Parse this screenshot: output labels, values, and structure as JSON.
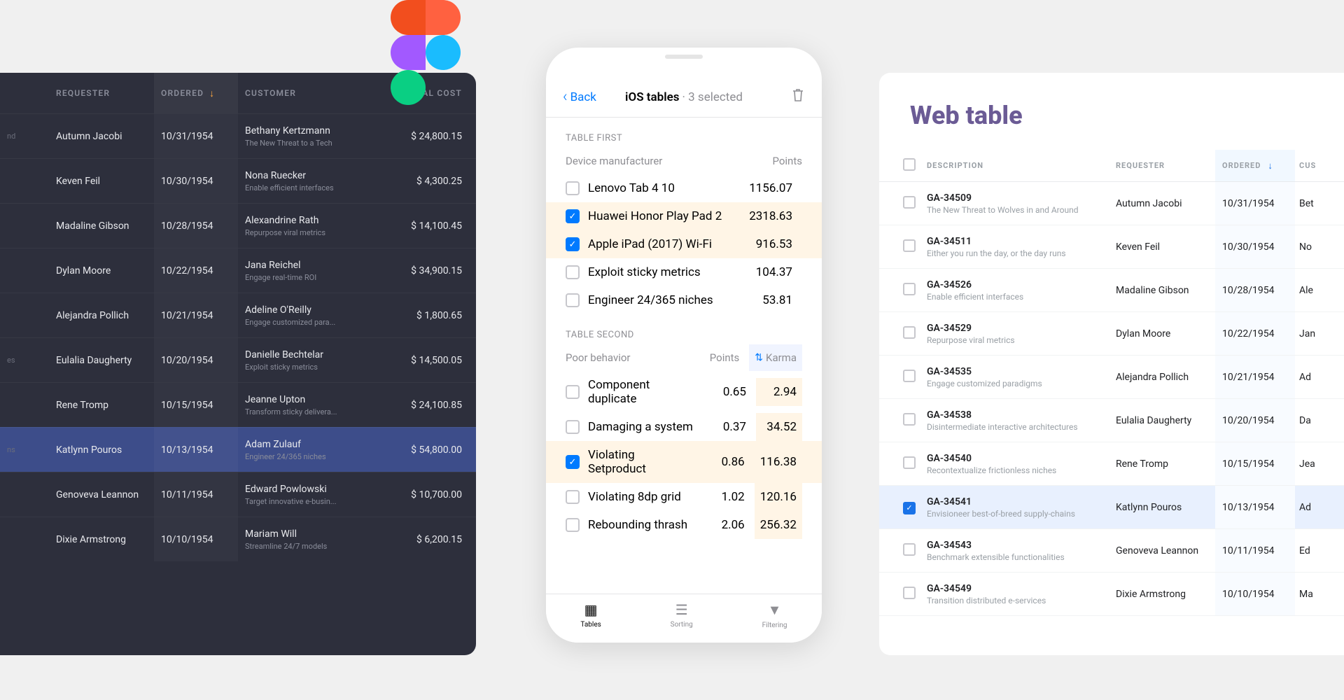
{
  "dark_table": {
    "headers": {
      "requester": "Requester",
      "ordered": "Ordered",
      "customer": "Customer",
      "total_cost": "Total Cost"
    },
    "rows": [
      {
        "stub": "nd",
        "requester": "Autumn Jacobi",
        "ordered": "10/31/1954",
        "cust_name": "Bethany Kertzmann",
        "cust_sub": "The New Threat to a Tech",
        "total": "$ 24,800.15",
        "selected": false
      },
      {
        "stub": "",
        "requester": "Keven Feil",
        "ordered": "10/30/1954",
        "cust_name": "Nona Ruecker",
        "cust_sub": "Enable efficient interfaces",
        "total": "$ 4,300.25",
        "selected": false
      },
      {
        "stub": "",
        "requester": "Madaline Gibson",
        "ordered": "10/28/1954",
        "cust_name": "Alexandrine Rath",
        "cust_sub": "Repurpose viral metrics",
        "total": "$ 14,100.45",
        "selected": false
      },
      {
        "stub": "",
        "requester": "Dylan Moore",
        "ordered": "10/22/1954",
        "cust_name": "Jana Reichel",
        "cust_sub": "Engage real-time ROI",
        "total": "$ 34,900.15",
        "selected": false
      },
      {
        "stub": "",
        "requester": "Alejandra Pollich",
        "ordered": "10/21/1954",
        "cust_name": "Adeline O'Reilly",
        "cust_sub": "Engage customized para...",
        "total": "$ 1,800.65",
        "selected": false
      },
      {
        "stub": "es",
        "requester": "Eulalia Daugherty",
        "ordered": "10/20/1954",
        "cust_name": "Danielle Bechtelar",
        "cust_sub": "Exploit sticky metrics",
        "total": "$ 14,500.05",
        "selected": false
      },
      {
        "stub": "",
        "requester": "Rene Tromp",
        "ordered": "10/15/1954",
        "cust_name": "Jeanne Upton",
        "cust_sub": "Transform sticky delivera...",
        "total": "$ 24,100.85",
        "selected": false
      },
      {
        "stub": "ns",
        "requester": "Katlynn Pouros",
        "ordered": "10/13/1954",
        "cust_name": "Adam Zulauf",
        "cust_sub": "Engineer 24/365 niches",
        "total": "$ 54,800.00",
        "selected": true
      },
      {
        "stub": "",
        "requester": "Genoveva Leannon",
        "ordered": "10/11/1954",
        "cust_name": "Edward Powlowski",
        "cust_sub": "Target innovative e-busin...",
        "total": "$ 10,700.00",
        "selected": false
      },
      {
        "stub": "",
        "requester": "Dixie Armstrong",
        "ordered": "10/10/1954",
        "cust_name": "Mariam Will",
        "cust_sub": "Streamline 24/7 models",
        "total": "$ 6,200.15",
        "selected": false
      }
    ]
  },
  "phone": {
    "back": "Back",
    "title": "iOS tables",
    "subtitle": "· 3 selected",
    "section1": "TABLE FIRST",
    "t1_col1": "Device manufacturer",
    "t1_col2": "Points",
    "t1_rows": [
      {
        "label": "Lenovo Tab 4 10",
        "val": "1156.07",
        "selected": false
      },
      {
        "label": "Huawei Honor Play Pad 2",
        "val": "2318.63",
        "selected": true
      },
      {
        "label": "Apple iPad (2017) Wi-Fi",
        "val": "916.53",
        "selected": true
      },
      {
        "label": "Exploit sticky metrics",
        "val": "104.37",
        "selected": false
      },
      {
        "label": "Engineer 24/365 niches",
        "val": "53.81",
        "selected": false
      }
    ],
    "section2": "TABLE SECOND",
    "t2_col1": "Poor behavior",
    "t2_col2": "Points",
    "t2_col3": "Karma",
    "t2_rows": [
      {
        "label": "Component duplicate",
        "pts": "0.65",
        "karma": "2.94",
        "selected": false
      },
      {
        "label": "Damaging a system",
        "pts": "0.37",
        "karma": "34.52",
        "selected": false
      },
      {
        "label": "Violating Setproduct",
        "pts": "0.86",
        "karma": "116.38",
        "selected": true
      },
      {
        "label": "Violating 8dp grid",
        "pts": "1.02",
        "karma": "120.16",
        "selected": false
      },
      {
        "label": "Rebounding thrash",
        "pts": "2.06",
        "karma": "256.32",
        "selected": false
      }
    ],
    "tabs": {
      "tables": "Tables",
      "sorting": "Sorting",
      "filtering": "Filtering"
    }
  },
  "web": {
    "title": "Web table",
    "headers": {
      "description": "Description",
      "requester": "Requester",
      "ordered": "Ordered",
      "customer": "Cus"
    },
    "rows": [
      {
        "code": "GA-34509",
        "sub": "The New Threat to Wolves in and Around",
        "req": "Autumn Jacobi",
        "ord": "10/31/1954",
        "cus": "Bet",
        "selected": false
      },
      {
        "code": "GA-34511",
        "sub": "Either you run the day, or the day runs",
        "req": "Keven Feil",
        "ord": "10/30/1954",
        "cus": "No",
        "selected": false
      },
      {
        "code": "GA-34526",
        "sub": "Enable efficient interfaces",
        "req": "Madaline Gibson",
        "ord": "10/28/1954",
        "cus": "Ale",
        "selected": false
      },
      {
        "code": "GA-34529",
        "sub": "Repurpose viral metrics",
        "req": "Dylan Moore",
        "ord": "10/22/1954",
        "cus": "Jan",
        "selected": false
      },
      {
        "code": "GA-34535",
        "sub": "Engage customized paradigms",
        "req": "Alejandra Pollich",
        "ord": "10/21/1954",
        "cus": "Ad",
        "selected": false
      },
      {
        "code": "GA-34538",
        "sub": "Disintermediate interactive architectures",
        "req": "Eulalia Daugherty",
        "ord": "10/20/1954",
        "cus": "Da",
        "selected": false
      },
      {
        "code": "GA-34540",
        "sub": "Recontextualize frictionless niches",
        "req": "Rene Tromp",
        "ord": "10/15/1954",
        "cus": "Jea",
        "selected": false
      },
      {
        "code": "GA-34541",
        "sub": "Envisioneer best-of-breed supply-chains",
        "req": "Katlynn Pouros",
        "ord": "10/13/1954",
        "cus": "Ad",
        "selected": true
      },
      {
        "code": "GA-34543",
        "sub": "Benchmark extensible functionalities",
        "req": "Genoveva Leannon",
        "ord": "10/11/1954",
        "cus": "Ed",
        "selected": false
      },
      {
        "code": "GA-34549",
        "sub": "Transition distributed e-services",
        "req": "Dixie Armstrong",
        "ord": "10/10/1954",
        "cus": "Ma",
        "selected": false
      }
    ]
  }
}
